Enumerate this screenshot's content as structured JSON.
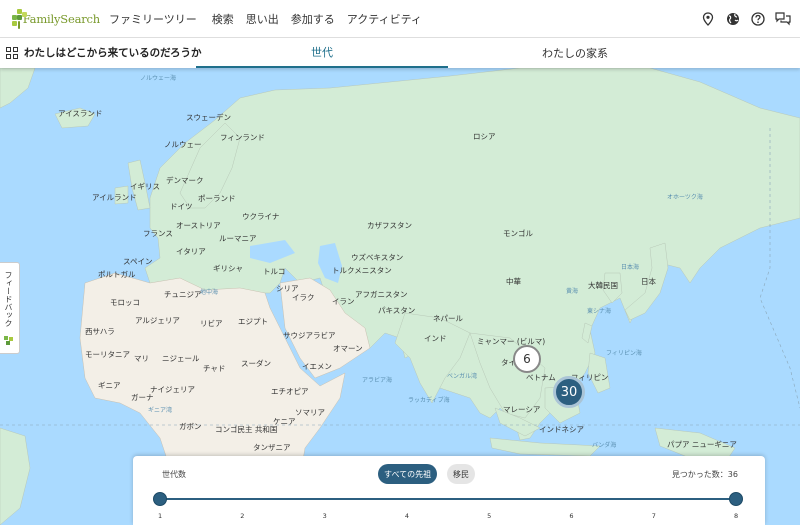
{
  "header": {
    "logo_text": "FamilySearch",
    "nav": [
      "ファミリーツリー",
      "検索",
      "思い出",
      "参加する",
      "アクティビティ"
    ],
    "icons": [
      "location-pin-icon",
      "globe-icon",
      "help-icon",
      "chat-icon"
    ]
  },
  "subheader": {
    "title": "わたしはどこから来ているのだろうか",
    "tabs": [
      "世代",
      "わたしの家系"
    ],
    "active_tab": "世代"
  },
  "feedback": {
    "label": "フィードバック"
  },
  "map": {
    "countries": [
      "アイスランド",
      "スウェーデン",
      "フィンランド",
      "ノルウェー",
      "ロシア",
      "デンマーク",
      "イギリス",
      "アイルランド",
      "ドイツ",
      "ポーランド",
      "ウクライナ",
      "フランス",
      "オーストリア",
      "ルーマニア",
      "イタリア",
      "スペイン",
      "ポルトガル",
      "ギリシャ",
      "トルコ",
      "カザフスタン",
      "モンゴル",
      "ウズベキスタン",
      "トルクメニスタン",
      "チュニジア",
      "モロッコ",
      "シリア",
      "イラク",
      "イラン",
      "アフガニスタン",
      "パキスタン",
      "中華",
      "大韓民国",
      "日本",
      "アルジェリア",
      "リビア",
      "エジプト",
      "西サハラ",
      "サウジアラビア",
      "ネパール",
      "インド",
      "モーリタニア",
      "マリ",
      "ニジェール",
      "チャド",
      "スーダン",
      "オマーン",
      "イエメン",
      "ミャンマー (ビルマ)",
      "タイ",
      "ベトナム",
      "フィリピン",
      "ギニア",
      "ナイジェリア",
      "エチオピア",
      "ガーナ",
      "ソマリア",
      "マレーシア",
      "ガボン",
      "コンゴ民主 共和国",
      "ケニア",
      "インドネシア",
      "タンザニア",
      "パプア ニューギニア"
    ],
    "seas": [
      "ノルウェー海",
      "オホーツク海",
      "日本海",
      "地中海",
      "黄海",
      "東シナ海",
      "フィリピン海",
      "アラビア海",
      "ベンガル湾",
      "ラッカディブ海",
      "ギニア湾",
      "バンダ海"
    ],
    "clusters": [
      {
        "count": "6",
        "style": "light"
      },
      {
        "count": "30",
        "style": "dark"
      }
    ]
  },
  "panel": {
    "label": "世代数",
    "filters": [
      "すべての先祖",
      "移民"
    ],
    "active_filter": "すべての先祖",
    "found_text": "見つかった数：36",
    "slider": {
      "min": 1,
      "max": 8,
      "low": 1,
      "high": 8,
      "ticks": [
        "1",
        "2",
        "3",
        "4",
        "5",
        "6",
        "7",
        "8"
      ]
    }
  },
  "colors": {
    "accent": "#2c5f80",
    "tab_active": "#1f6f8b",
    "logo": "#7a9a2d",
    "water": "#aadaff",
    "land": "#d3ecd6"
  }
}
